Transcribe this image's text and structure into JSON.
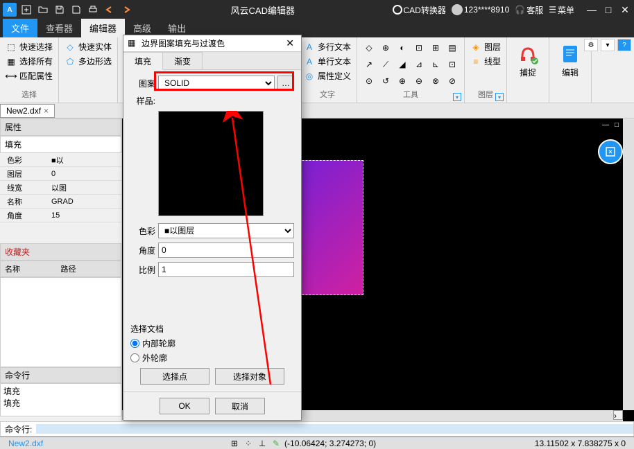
{
  "app": {
    "title": "风云CAD编辑器",
    "user": "123****8910"
  },
  "titlebar": {
    "converter": "CAD转换器",
    "support": "客服",
    "menu": "菜单"
  },
  "tabs": {
    "file": "文件",
    "viewer": "查看器",
    "editor": "编辑器",
    "advanced": "高级",
    "output": "输出"
  },
  "ribbon": {
    "quick_select": "快速选择",
    "select_all": "选择所有",
    "match_props": "匹配属性",
    "select_group": "选择",
    "quick_entity": "快速实体",
    "poly_select": "多边形选",
    "multiline_text": "多行文本",
    "single_line_text": "单行文本",
    "attr_def": "属性定义",
    "text_group": "文字",
    "tools_group": "工具",
    "layer": "图层",
    "linetype": "线型",
    "layer_group": "图层",
    "snap": "捕捉",
    "edit": "编辑"
  },
  "document": {
    "tab": "New2.dxf"
  },
  "properties": {
    "title": "属性",
    "fill": "填充",
    "rows": [
      {
        "label": "色彩",
        "value": "■以"
      },
      {
        "label": "图层",
        "value": "0"
      },
      {
        "label": "线宽",
        "value": "以图"
      },
      {
        "label": "名称",
        "value": "GRAD"
      },
      {
        "label": "角度",
        "value": "15"
      }
    ]
  },
  "favorites": {
    "title": "收藏夹",
    "col_name": "名称",
    "col_path": "路径"
  },
  "command": {
    "title": "命令行",
    "history": [
      "填充",
      "填充"
    ],
    "prompt": "命令行:"
  },
  "statusbar": {
    "file": "New2.dxf",
    "coords": "(-10.06424; 3.274273; 0)",
    "zoom": "13.11502 x 7.838275 x 0"
  },
  "dialog": {
    "title": "边界图案填充与过渡色",
    "tab_fill": "填充",
    "tab_gradient": "渐变",
    "pattern_label": "图案",
    "pattern_value": "SOLID",
    "sample_label": "样品:",
    "color_label": "色彩",
    "color_value": "■以图层",
    "angle_label": "角度",
    "angle_value": "0",
    "scale_label": "比例",
    "scale_value": "1",
    "select_doc": "选择文档",
    "internal_contour": "内部轮廓",
    "external_contour": "外轮廓",
    "select_point": "选择点",
    "select_object": "选择对象",
    "ok": "OK",
    "cancel": "取消"
  }
}
